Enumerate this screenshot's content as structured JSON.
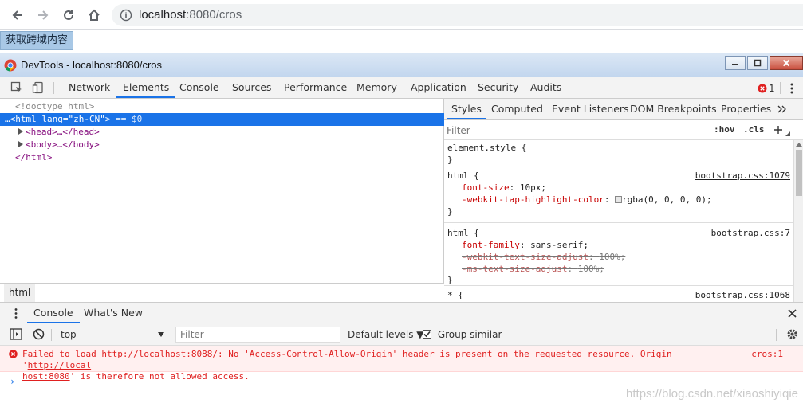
{
  "browser": {
    "url_host": "localhost",
    "url_rest": ":8080/cros"
  },
  "page": {
    "fetch_button": "获取跨域内容"
  },
  "devtools": {
    "window_title": "DevTools - localhost:8080/cros",
    "tabs": [
      "Network",
      "Elements",
      "Console",
      "Sources",
      "Performance",
      "Memory",
      "Application",
      "Security",
      "Audits"
    ],
    "active_tab": "Elements",
    "error_count": "1",
    "elements": {
      "doctype": "<!doctype html>",
      "html_open_tag": "<html",
      "html_attr_name": "lang",
      "html_attr_value": "\"zh-CN\"",
      "html_close_bracket": ">",
      "selected_suffix": " == $0",
      "head_tag": "<head>…</head>",
      "body_tag": "<body>…</body>",
      "html_close": "</html>",
      "breadcrumb": "html"
    },
    "styles_pane": {
      "tabs": [
        "Styles",
        "Computed",
        "Event Listeners",
        "DOM Breakpoints",
        "Properties"
      ],
      "filter_placeholder": "Filter",
      "hov": ":hov",
      "cls": ".cls",
      "rules": {
        "element_style_open": "element.style {",
        "close_brace": "}",
        "html_rule1_selector": "html {",
        "html_rule1_source": "bootstrap.css:1079",
        "html_rule1_p1_name": "font-size",
        "html_rule1_p1_value": "10px;",
        "html_rule1_p2_name": "-webkit-tap-highlight-color",
        "html_rule1_p2_value": "rgba(0, 0, 0, 0);",
        "html_rule2_selector": "html {",
        "html_rule2_source": "bootstrap.css:7",
        "html_rule2_p1_name": "font-family",
        "html_rule2_p1_value": "sans-serif;",
        "html_rule2_p2_name": "-webkit-text-size-adjust",
        "html_rule2_p2_value": "100%;",
        "html_rule2_p3_name": "-ms-text-size-adjust",
        "html_rule2_p3_value": "100%;",
        "star_rule_selector": "* {",
        "star_rule_source": "bootstrap.css:1068"
      }
    },
    "drawer": {
      "tabs": [
        "Console",
        "What's New"
      ],
      "context": "top",
      "filter_placeholder": "Filter",
      "levels": "Default levels ▼",
      "group_similar": "Group similar"
    },
    "console": {
      "error_prefix": "Failed to load ",
      "error_url": "http://localhost:8088/",
      "error_mid": ": No 'Access-Control-Allow-Origin' header is present on the requested resource. Origin '",
      "error_origin_a": "http://local",
      "error_origin_b": "host:8080",
      "error_suffix": "' is therefore not allowed access.",
      "error_source": "cros:1",
      "prompt": "›",
      "watermark": "https://blog.csdn.net/xiaoshiyiqie"
    }
  },
  "colors": {
    "accent": "#1a73e8",
    "error": "#e02020",
    "error_bg": "#fff0f0"
  }
}
